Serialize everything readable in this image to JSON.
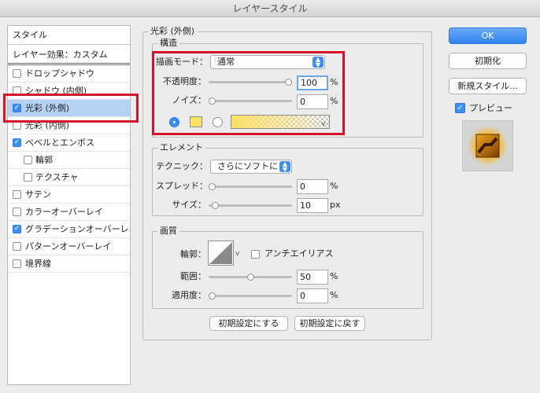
{
  "window": {
    "title": "レイヤースタイル"
  },
  "left_panel": {
    "header": "スタイル",
    "effects_label": "レイヤー効果：カスタム",
    "items": [
      {
        "label": "ドロップシャドウ",
        "checked": false,
        "sub": false,
        "selected": false
      },
      {
        "label": "シャドウ (内側)",
        "checked": false,
        "sub": false,
        "selected": false
      },
      {
        "label": "光彩 (外側)",
        "checked": true,
        "sub": false,
        "selected": true
      },
      {
        "label": "光彩 (内側)",
        "checked": false,
        "sub": false,
        "selected": false
      },
      {
        "label": "ベベルとエンボス",
        "checked": true,
        "sub": false,
        "selected": false
      },
      {
        "label": "輪郭",
        "checked": false,
        "sub": true,
        "selected": false
      },
      {
        "label": "テクスチャ",
        "checked": false,
        "sub": true,
        "selected": false
      },
      {
        "label": "サテン",
        "checked": false,
        "sub": false,
        "selected": false
      },
      {
        "label": "カラーオーバーレイ",
        "checked": false,
        "sub": false,
        "selected": false
      },
      {
        "label": "グラデーションオーバーレイ",
        "checked": true,
        "sub": false,
        "selected": false
      },
      {
        "label": "パターンオーバーレイ",
        "checked": false,
        "sub": false,
        "selected": false
      },
      {
        "label": "境界線",
        "checked": false,
        "sub": false,
        "selected": false
      }
    ]
  },
  "outer_glow": {
    "title": "光彩 (外側)",
    "structure": {
      "title": "構造",
      "blend_mode_label": "描画モード：",
      "blend_mode_value": "通常",
      "opacity_label": "不透明度：",
      "opacity_value": "100",
      "opacity_unit": "%",
      "opacity_slider_fraction": 1.0,
      "noise_label": "ノイズ：",
      "noise_value": "0",
      "noise_unit": "%",
      "noise_slider_fraction": 0.0,
      "color_swatch": "#ffe063",
      "dropdown_glyph": "v"
    },
    "elements": {
      "title": "エレメント",
      "technique_label": "テクニック：",
      "technique_value": "さらにソフトに",
      "spread_label": "スプレッド：",
      "spread_value": "0",
      "spread_unit": "%",
      "spread_slider_fraction": 0.0,
      "size_label": "サイズ：",
      "size_value": "10",
      "size_unit": "px",
      "size_slider_fraction": 0.04
    },
    "quality": {
      "title": "画質",
      "contour_label": "輪郭：",
      "antialias_label": "アンチエイリアス",
      "antialias_checked": false,
      "range_label": "範囲：",
      "range_value": "50",
      "range_unit": "%",
      "range_slider_fraction": 0.5,
      "jitter_label": "適用度：",
      "jitter_value": "0",
      "jitter_unit": "%",
      "jitter_slider_fraction": 0.0
    },
    "make_default": "初期設定にする",
    "reset_default": "初期設定に戻す"
  },
  "buttons": {
    "ok": "OK",
    "reset": "初期化",
    "new_style": "新規スタイル...",
    "preview_label": "プレビュー",
    "preview_checked": true
  },
  "colors": {
    "accent": "#3d8ff0",
    "highlight_red": "#d4122a",
    "glow_yellow": "#ffe063"
  }
}
